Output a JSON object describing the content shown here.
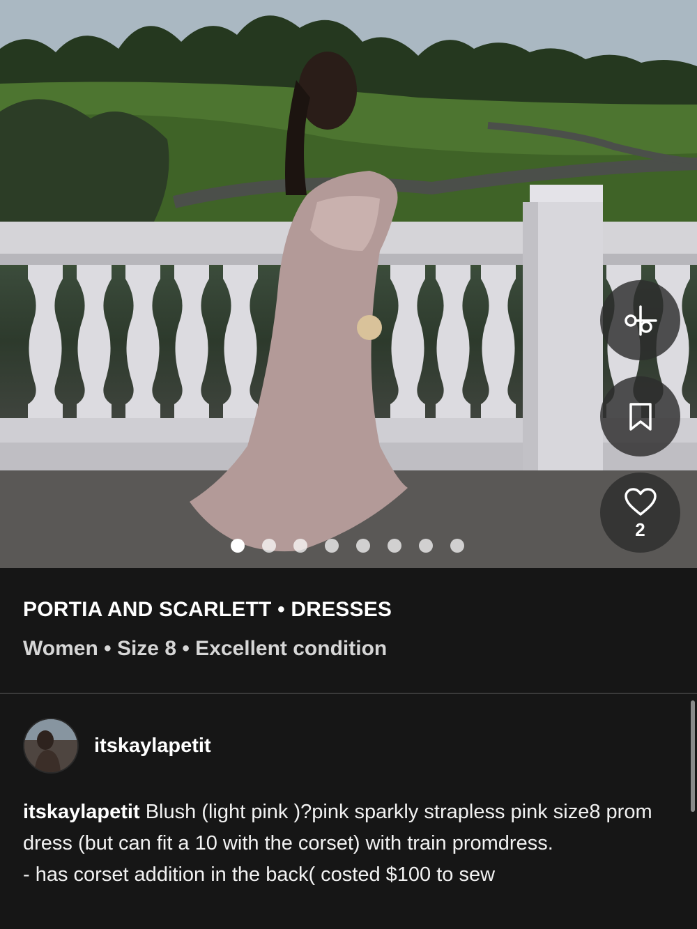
{
  "listing": {
    "brand_line": "PORTIA AND SCARLETT • DRESSES",
    "details_line": "Women • Size 8 • Excellent condition"
  },
  "actions": {
    "offer_icon": "scissors-offer-icon",
    "save_icon": "bookmark-icon",
    "like_icon": "heart-icon",
    "like_count": "2"
  },
  "carousel": {
    "total_images": 8,
    "active_index": 0
  },
  "seller": {
    "username": "itskaylapetit"
  },
  "description": {
    "username": "itskaylapetit",
    "text": " Blush (light pink )?pink sparkly strapless pink size8 prom dress (but can fit a 10 with the corset) with train  promdress.\n- has corset addition in the back( costed $100 to sew"
  }
}
